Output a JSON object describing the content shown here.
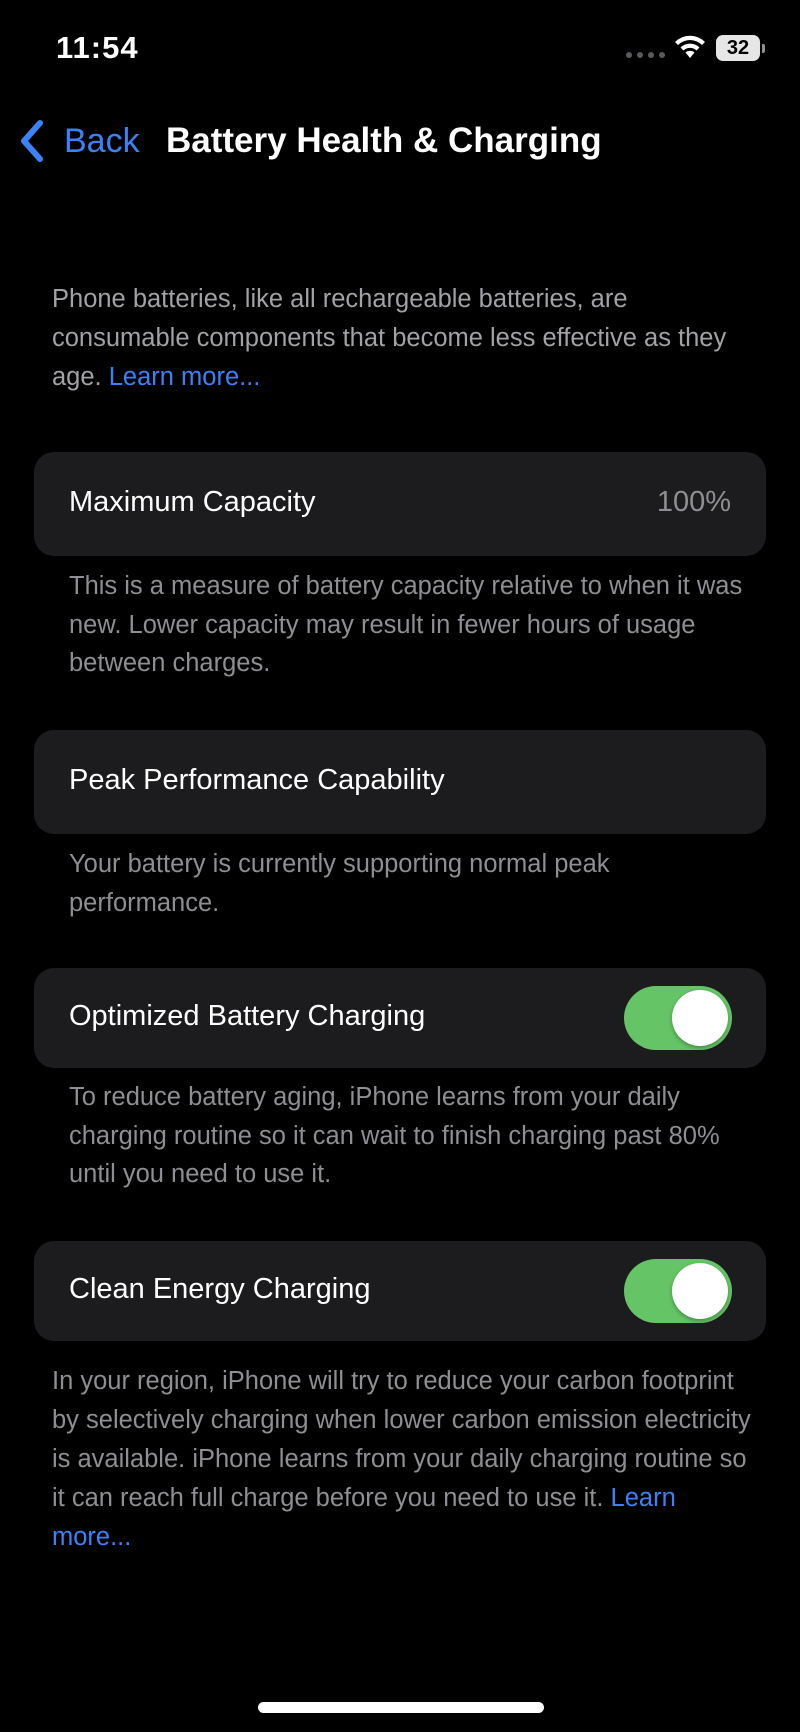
{
  "status_bar": {
    "time": "11:54",
    "battery_level": "32",
    "icons": [
      "signal-dots-icon",
      "wifi-icon",
      "battery-icon"
    ]
  },
  "nav": {
    "back_label": "Back",
    "title": "Battery Health & Charging"
  },
  "intro": {
    "text": "Phone batteries, like all rechargeable batteries, are consumable components that become less effective as they age.",
    "link": "Learn more..."
  },
  "max_capacity": {
    "label": "Maximum Capacity",
    "value": "100%",
    "footnote": "This is a measure of battery capacity relative to when it was new. Lower capacity may result in fewer hours of usage between charges."
  },
  "peak_performance": {
    "label": "Peak Performance Capability",
    "footnote": "Your battery is currently supporting normal peak performance."
  },
  "optimized_charging": {
    "label": "Optimized Battery Charging",
    "enabled": true,
    "footnote": "To reduce battery aging, iPhone learns from your daily charging routine so it can wait to finish charging past 80% until you need to use it."
  },
  "clean_energy": {
    "label": "Clean Energy Charging",
    "enabled": true,
    "footnote": "In your region, iPhone will try to reduce your carbon footprint by selectively charging when lower carbon emission electricity is available. iPhone learns from your daily charging routine so it can reach full charge before you need to use it.",
    "link": "Learn more..."
  },
  "colors": {
    "background": "#000000",
    "card": "#1c1c1e",
    "accent_link": "#3b82f6",
    "toggle_on": "#65c466",
    "secondary_text": "#8e8e93"
  }
}
